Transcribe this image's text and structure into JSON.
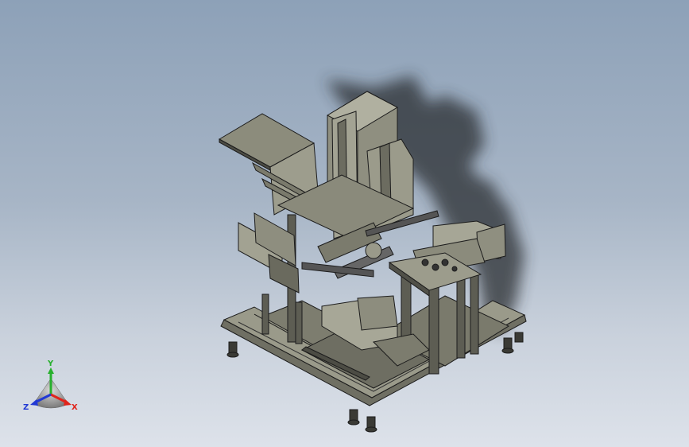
{
  "viewport": {
    "background_top": "#8da1b8",
    "background_bottom": "#dde2ea"
  },
  "model": {
    "part_color": "#8c8c7c",
    "edge_color": "#1c1c1c",
    "shadow_color": "#2a2d31"
  },
  "triad": {
    "x_label": "X",
    "y_label": "Y",
    "z_label": "Z",
    "x_color": "#e0241b",
    "y_color": "#27b02d",
    "z_color": "#2139d4"
  }
}
